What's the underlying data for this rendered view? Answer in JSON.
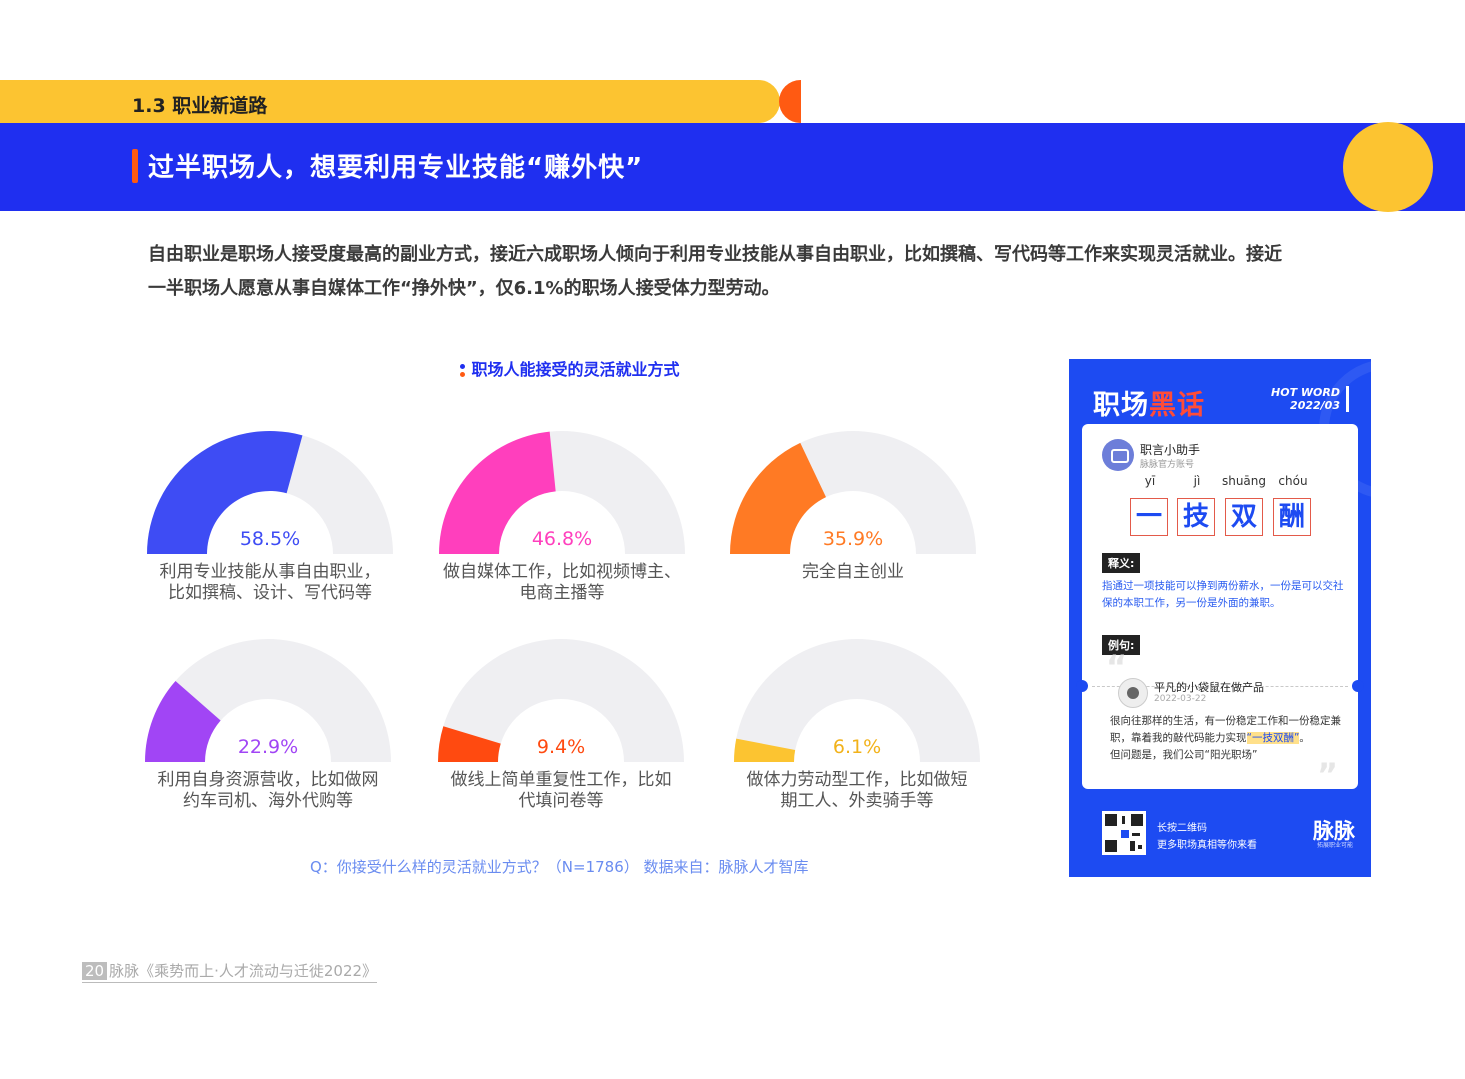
{
  "section": {
    "label": "1.3 职业新道路"
  },
  "header": {
    "title": "过半职场人，想要利用专业技能“赚外快”"
  },
  "intro": {
    "line1": "自由职业是职场人接受度最高的副业方式，接近六成职场人倾向于利用专业技能从事自由职业，比如撰稿、写代码等工作来实现灵活就业。接近",
    "line2": "一半职场人愿意从事自媒体工作“挣外快”，仅6.1%的职场人接受体力型劳动。"
  },
  "chart_data": {
    "type": "gauge",
    "title": "职场人能接受的灵活就业方式",
    "unit": "%",
    "items": [
      {
        "value": 58.5,
        "display": "58.5%",
        "label_lines": [
          "利用专业技能从事自由职业，",
          "比如撰稿、设计、写代码等"
        ],
        "color": "#3e4cf4"
      },
      {
        "value": 46.8,
        "display": "46.8%",
        "label_lines": [
          "做自媒体工作，比如视频博主、",
          "电商主播等"
        ],
        "color": "#ff3fbd"
      },
      {
        "value": 35.9,
        "display": "35.9%",
        "label_lines": [
          "完全自主创业"
        ],
        "color": "#ff7a24"
      },
      {
        "value": 22.9,
        "display": "22.9%",
        "label_lines": [
          "利用自身资源营收，比如做网",
          "约车司机、海外代购等"
        ],
        "color": "#a145f5"
      },
      {
        "value": 9.4,
        "display": "9.4%",
        "label_lines": [
          "做线上简单重复性工作，比如",
          "代填问卷等"
        ],
        "color": "#ff4a10"
      },
      {
        "value": 6.1,
        "display": "6.1%",
        "label_lines": [
          "做体力劳动型工作，比如做短",
          "期工人、外卖骑手等"
        ],
        "color": "#fcc431"
      }
    ],
    "track_color": "#efeff2"
  },
  "source": "Q：你接受什么样的灵活就业方式？（N=1786） 数据来自：脉脉人才智库",
  "footer": {
    "page": "20",
    "text": "脉脉《乘势而上·人才流动与迁徙2022》"
  },
  "card": {
    "headline_a": "职场",
    "headline_b": "黑话",
    "hot_word": "HOT WORD",
    "date": "2022/03",
    "account_name": "职言小助手",
    "account_sub": "脉脉官方账号",
    "pinyin": [
      "yī",
      "jì",
      "shuāng",
      "chóu"
    ],
    "chars": [
      "一",
      "技",
      "双",
      "酬"
    ],
    "def_tag": "释义:",
    "definition": "指通过一项技能可以挣到两份薪水，一份是可以交社保的本职工作，另一份是外面的兼职。",
    "example_tag": "例句:",
    "user_name": "平凡的小袋鼠在做产品",
    "user_date": "2022-03-22",
    "example_a": "很向往那样的生活，有一份稳定工作和一份稳定兼职，靠着我的敲代码能力实现",
    "example_hl": "“一技双酬”",
    "example_b": "。",
    "example_c": "但问题是，我们公司“阳光职场”",
    "cta1": "长按二维码",
    "cta2": "更多职场真相等你来看",
    "brand": "脉脉",
    "brand_sub": "拓展职业可能"
  }
}
